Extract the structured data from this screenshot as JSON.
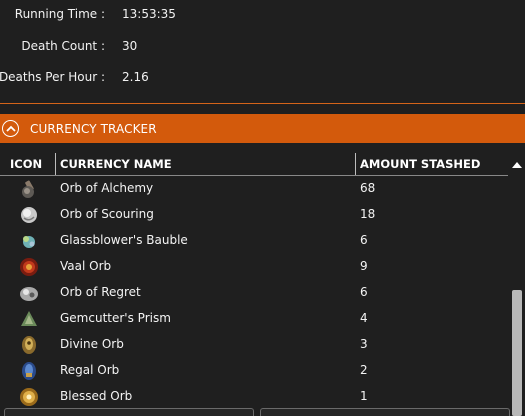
{
  "stats": {
    "running_time_label": "Running Time :",
    "running_time_value": "13:53:35",
    "death_count_label": "Death Count :",
    "death_count_value": "30",
    "deaths_per_hour_label": "Deaths Per Hour :",
    "deaths_per_hour_value": "2.16"
  },
  "panel": {
    "title": "CURRENCY TRACKER",
    "accent_color": "#d35a0c",
    "collapse_icon": "chevron-up-icon"
  },
  "table": {
    "headers": {
      "icon": "ICON",
      "name": "CURRENCY NAME",
      "amount": "AMOUNT STASHED"
    },
    "rows": [
      {
        "icon": "orb-of-alchemy-icon",
        "name": "Orb of Alchemy",
        "amount": "68"
      },
      {
        "icon": "orb-of-scouring-icon",
        "name": "Orb of Scouring",
        "amount": "18"
      },
      {
        "icon": "glassblowers-bauble-icon",
        "name": "Glassblower's Bauble",
        "amount": "6"
      },
      {
        "icon": "vaal-orb-icon",
        "name": "Vaal Orb",
        "amount": "9"
      },
      {
        "icon": "orb-of-regret-icon",
        "name": "Orb of Regret",
        "amount": "6"
      },
      {
        "icon": "gemcutters-prism-icon",
        "name": "Gemcutter's Prism",
        "amount": "4"
      },
      {
        "icon": "divine-orb-icon",
        "name": "Divine Orb",
        "amount": "3"
      },
      {
        "icon": "regal-orb-icon",
        "name": "Regal Orb",
        "amount": "2"
      },
      {
        "icon": "blessed-orb-icon",
        "name": "Blessed Orb",
        "amount": "1"
      }
    ]
  }
}
